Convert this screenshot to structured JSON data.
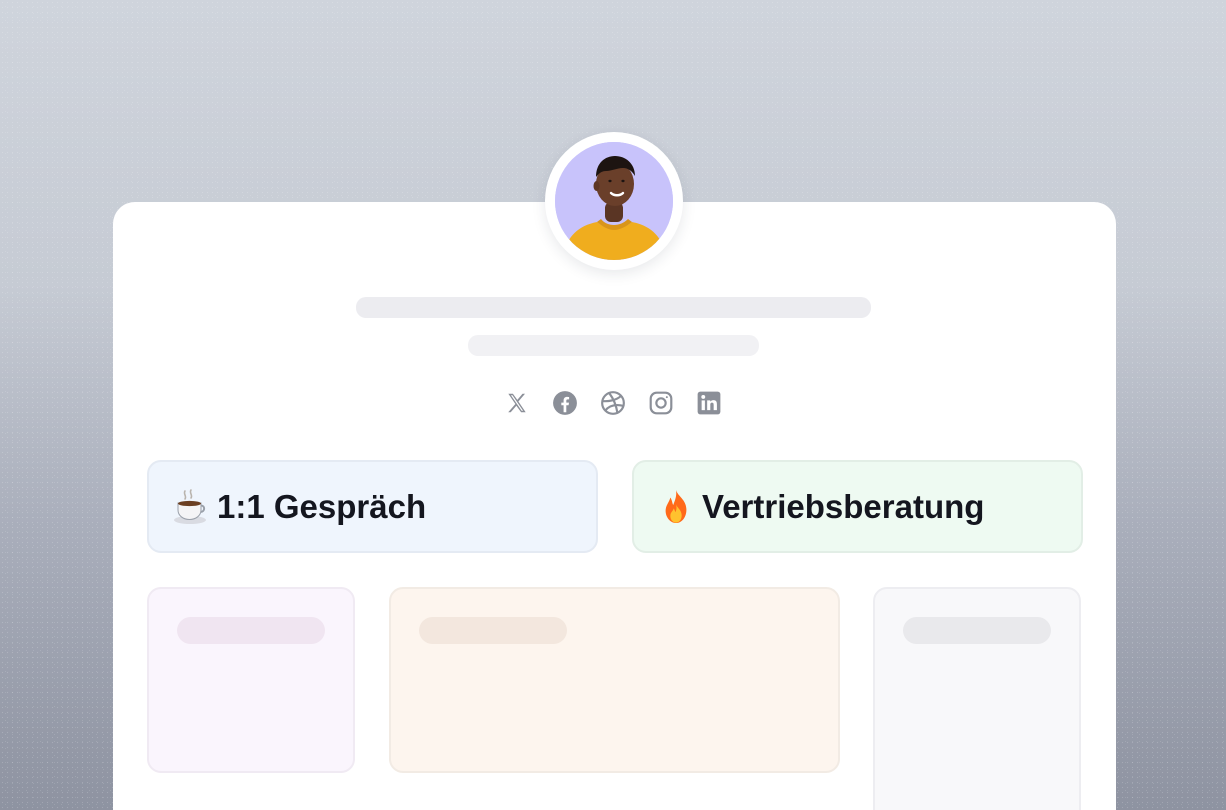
{
  "profile": {
    "avatar_icon": "person-avatar",
    "avatar_bg": "#c8c3fb"
  },
  "socials": [
    {
      "icon": "x-icon"
    },
    {
      "icon": "facebook-icon"
    },
    {
      "icon": "dribbble-icon"
    },
    {
      "icon": "instagram-icon"
    },
    {
      "icon": "linkedin-icon"
    }
  ],
  "events": [
    {
      "emoji": "coffee-cup-icon",
      "label": "1:1 Gespräch",
      "bg": "#eff5fd"
    },
    {
      "emoji": "fire-icon",
      "label": "Vertriebsberatung",
      "bg": "#eefaf2"
    }
  ],
  "colors": {
    "card": "#ffffff",
    "icon_gray": "#8b8f98",
    "text": "#14161f"
  }
}
